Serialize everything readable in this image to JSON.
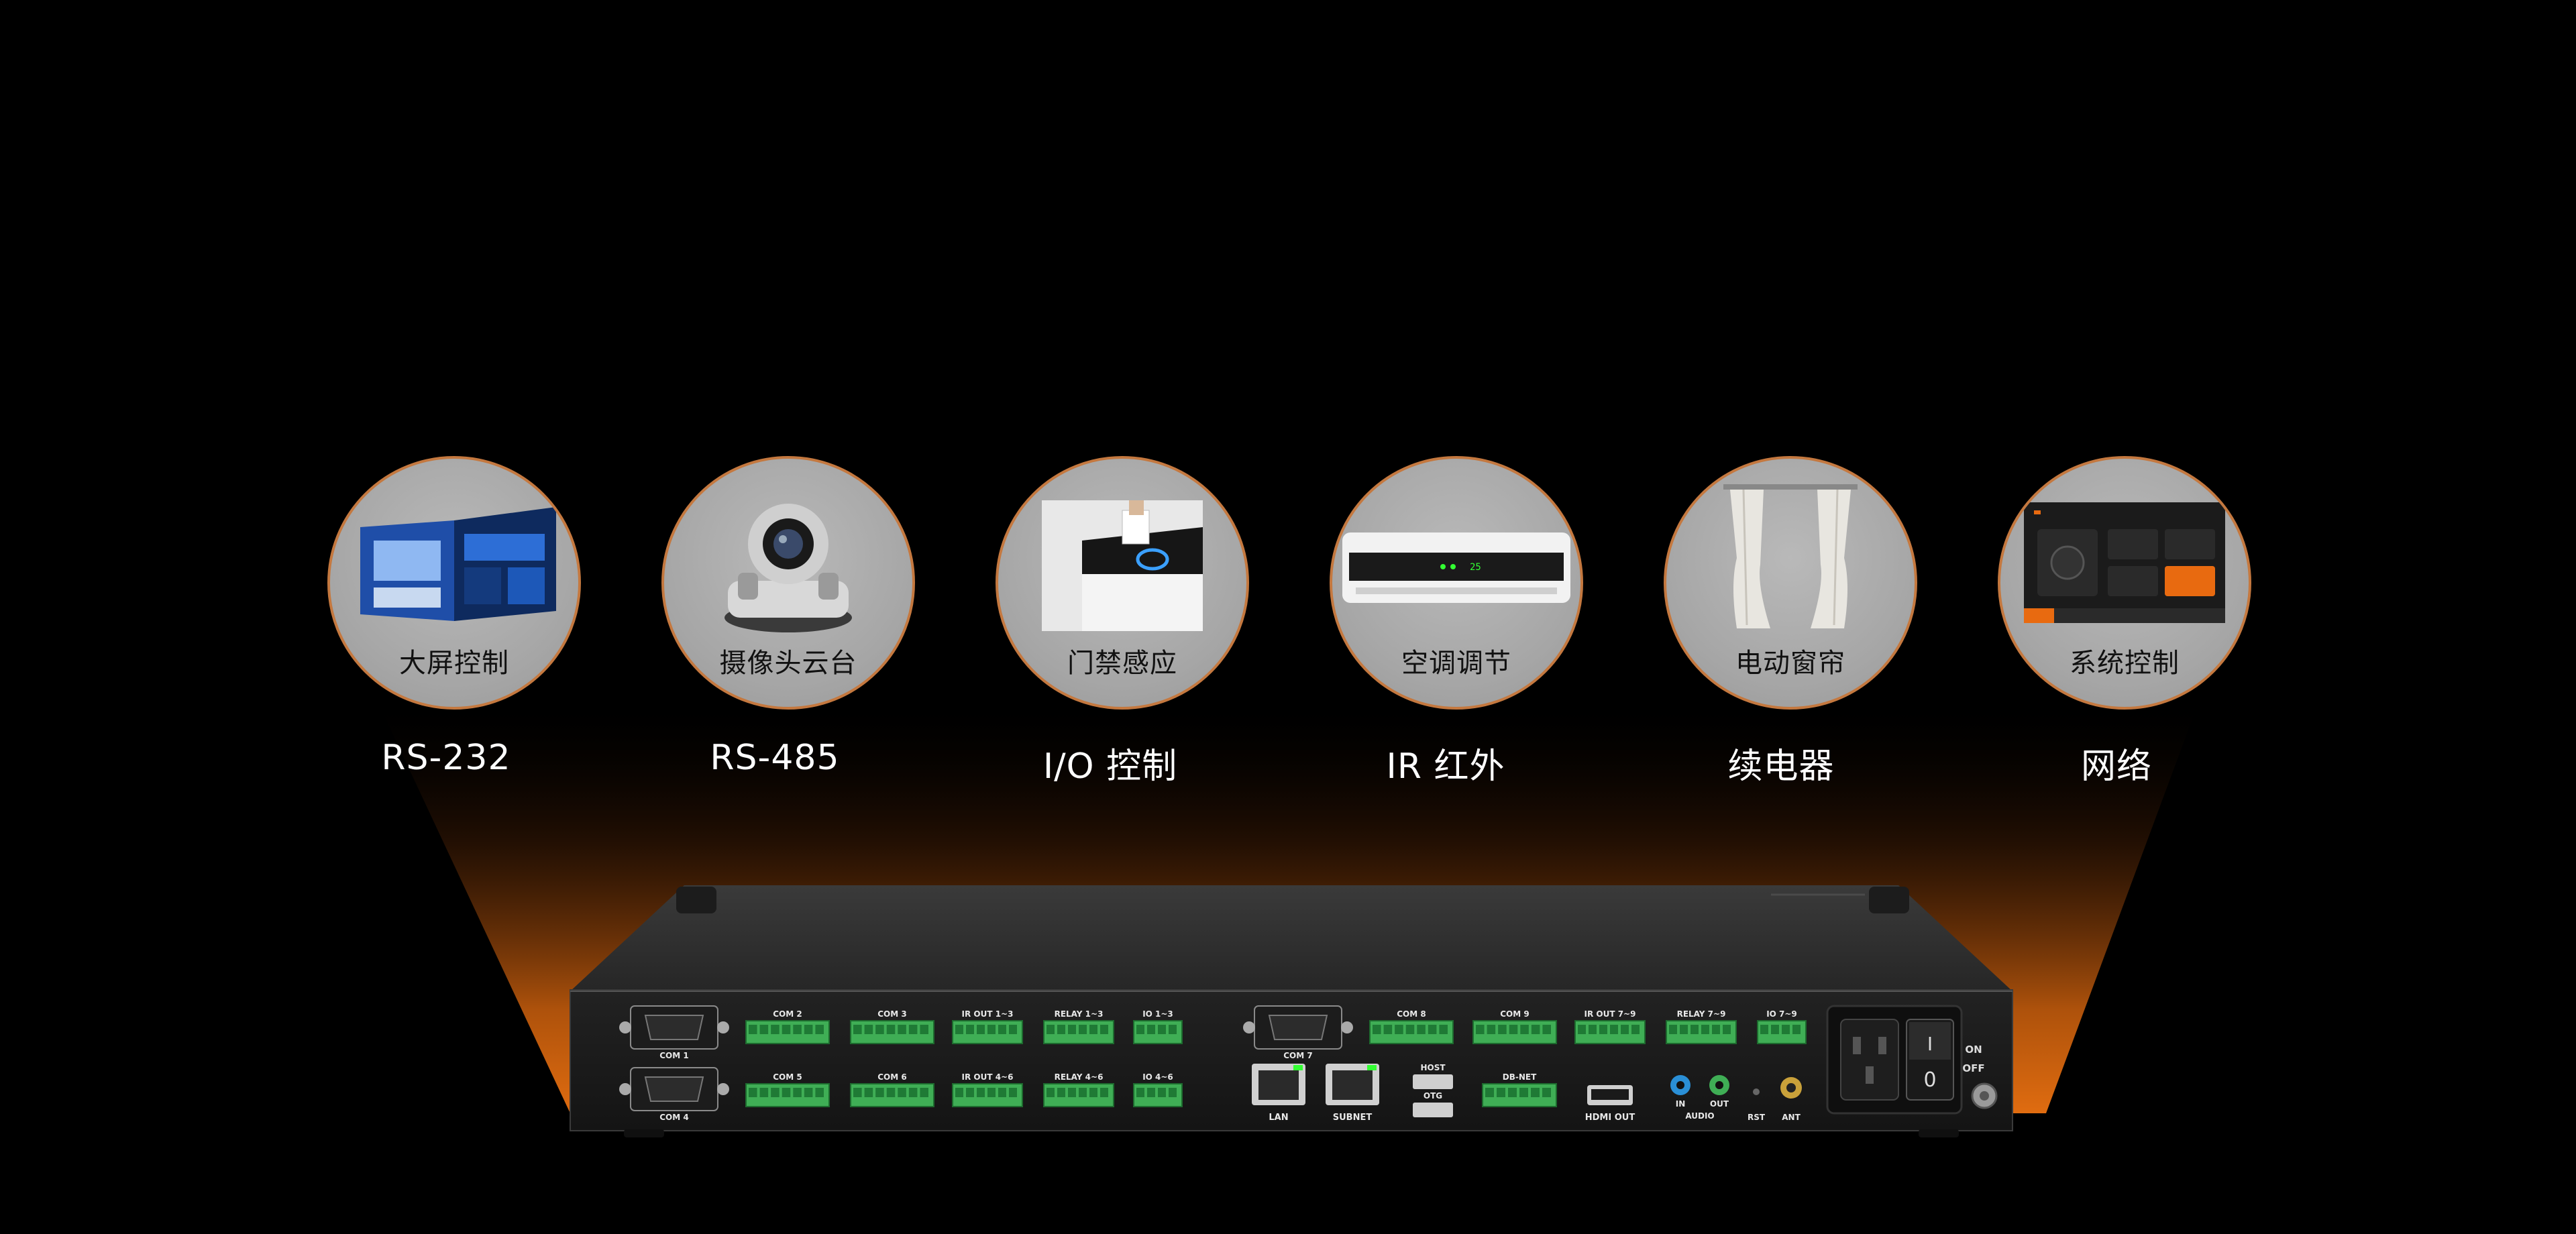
{
  "features": [
    {
      "name": "大屏控制",
      "protocol": "RS-232",
      "icon": "video-wall-icon"
    },
    {
      "name": "摄像头云台",
      "protocol": "RS-485",
      "icon": "ptz-camera-icon"
    },
    {
      "name": "门禁感应",
      "protocol": "I/O 控制",
      "icon": "access-card-icon"
    },
    {
      "name": "空调调节",
      "protocol": "IR 红外",
      "icon": "air-conditioner-icon"
    },
    {
      "name": "电动窗帘",
      "protocol": "续电器",
      "icon": "curtain-icon"
    },
    {
      "name": "系统控制",
      "protocol": "网络",
      "icon": "control-panel-icon"
    }
  ],
  "colors": {
    "accent": "#c4783f",
    "glow": "#d9690f",
    "terminal_green": "#3fae55",
    "chassis": "#2a2a2a"
  },
  "device": {
    "top_row_labels": [
      "COM 2",
      "COM 3",
      "IR OUT 1~3",
      "RELAY 1~3",
      "IO 1~3",
      "COM 8",
      "COM 9",
      "IR OUT 7~9",
      "RELAY 7~9",
      "IO 7~9"
    ],
    "bottom_row_labels": [
      "COM 5",
      "COM 6",
      "IR OUT 4~6",
      "RELAY 4~6",
      "IO 4~6",
      "DB-NET"
    ],
    "db9_labels": [
      "COM 1",
      "COM 4",
      "COM 7"
    ],
    "port_labels": [
      "LAN",
      "SUBNET",
      "HOST",
      "OTG",
      "HDMI OUT",
      "IN",
      "OUT",
      "AUDIO",
      "RST",
      "ANT"
    ],
    "power_labels": [
      "ON",
      "OFF"
    ],
    "switch_marks": [
      "I",
      "0"
    ]
  }
}
